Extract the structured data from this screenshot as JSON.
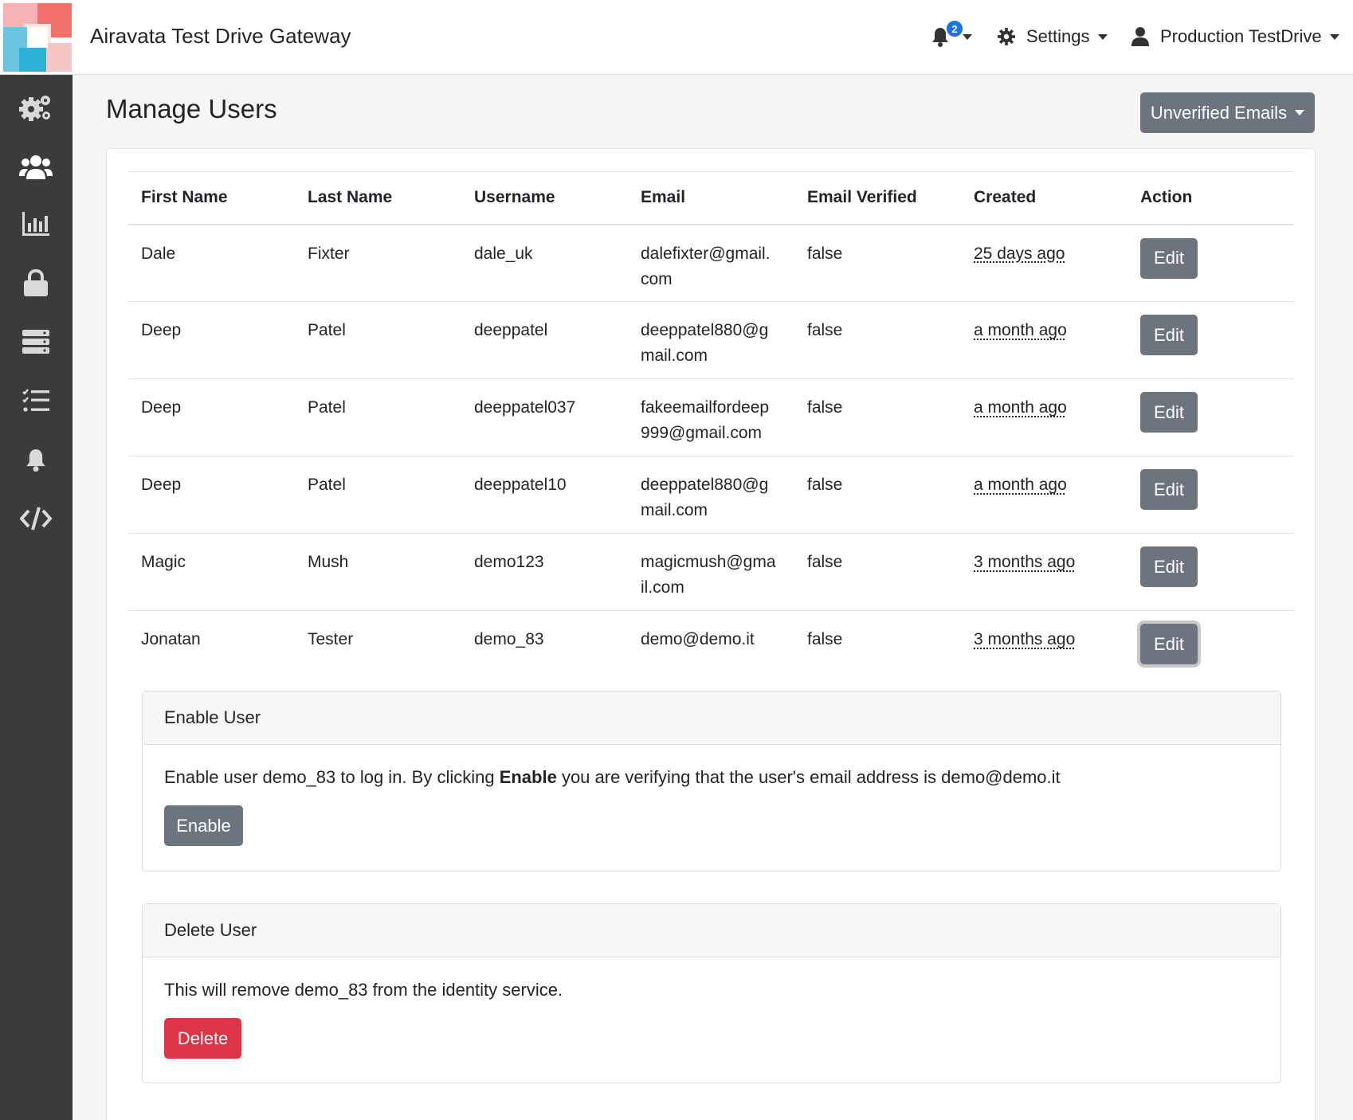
{
  "header": {
    "app_title": "Airavata Test Drive Gateway",
    "notification_count": "2",
    "settings_label": "Settings",
    "user_label": "Production TestDrive"
  },
  "sidebar": {
    "items": [
      {
        "icon": "gears-icon"
      },
      {
        "icon": "users-icon"
      },
      {
        "icon": "chart-icon"
      },
      {
        "icon": "lock-icon"
      },
      {
        "icon": "server-icon"
      },
      {
        "icon": "tasks-icon"
      },
      {
        "icon": "bell-icon"
      },
      {
        "icon": "code-icon"
      }
    ]
  },
  "page": {
    "title": "Manage Users",
    "unverified_emails_label": "Unverified Emails"
  },
  "table": {
    "headers": [
      "First Name",
      "Last Name",
      "Username",
      "Email",
      "Email Verified",
      "Created",
      "Action"
    ],
    "rows": [
      {
        "first": "Dale",
        "last": "Fixter",
        "username": "dale_uk",
        "email_1": "dalefixter@gmail.",
        "email_2": "com",
        "verified": "false",
        "created": "25 days ago",
        "action": "Edit"
      },
      {
        "first": "Deep",
        "last": "Patel",
        "username": "deeppatel",
        "email_1": "deeppatel880@g",
        "email_2": "mail.com",
        "verified": "false",
        "created": "a month ago",
        "action": "Edit"
      },
      {
        "first": "Deep",
        "last": "Patel",
        "username": "deeppatel037",
        "email_1": "fakeemailfordeep",
        "email_2": "999@gmail.com",
        "verified": "false",
        "created": "a month ago",
        "action": "Edit"
      },
      {
        "first": "Deep",
        "last": "Patel",
        "username": "deeppatel10",
        "email_1": "deeppatel880@g",
        "email_2": "mail.com",
        "verified": "false",
        "created": "a month ago",
        "action": "Edit"
      },
      {
        "first": "Magic",
        "last": "Mush",
        "username": "demo123",
        "email_1": "magicmush@gma",
        "email_2": "il.com",
        "verified": "false",
        "created": "3 months ago",
        "action": "Edit"
      },
      {
        "first": "Jonatan",
        "last": "Tester",
        "username": "demo_83",
        "email_1": "demo@demo.it",
        "email_2": "",
        "verified": "false",
        "created": "3 months ago",
        "action": "Edit"
      }
    ]
  },
  "enable_card": {
    "title": "Enable User",
    "text_before": "Enable user demo_83 to log in. By clicking ",
    "text_bold": "Enable",
    "text_after": " you are verifying that the user's email address is demo@demo.it",
    "button_label": "Enable"
  },
  "delete_card": {
    "title": "Delete User",
    "text": "This will remove demo_83 from the identity service.",
    "button_label": "Delete"
  },
  "colors": {
    "sidebar": "#3b3b3b",
    "secondary_button": "#6c757d",
    "danger_button": "#dc3545",
    "badge": "#1a73e8"
  }
}
